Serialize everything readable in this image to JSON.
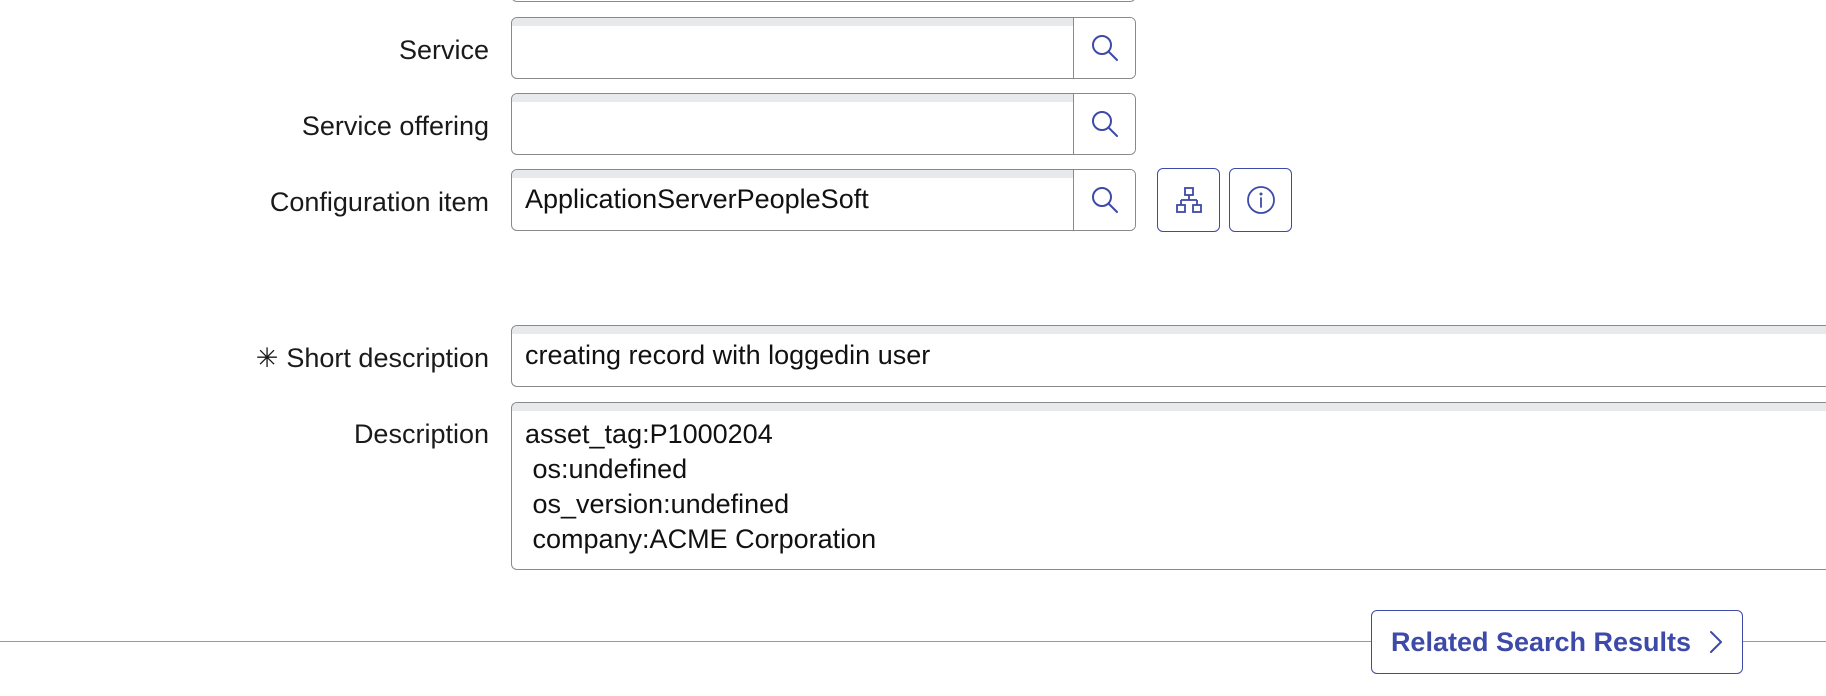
{
  "form": {
    "service": {
      "label": "Service",
      "value": "",
      "lookup_icon": "search-icon"
    },
    "service_offering": {
      "label": "Service offering",
      "value": "",
      "lookup_icon": "search-icon"
    },
    "configuration_item": {
      "label": "Configuration item",
      "value": "ApplicationServerPeopleSoft",
      "lookup_icon": "search-icon",
      "extra_icons": [
        "dependency-map-icon",
        "info-icon"
      ]
    },
    "short_description": {
      "required_marker": "✳",
      "label": "Short description",
      "value": "creating record with loggedin user"
    },
    "description": {
      "label": "Description",
      "lines": [
        "asset_tag:P1000204",
        " os:undefined",
        " os_version:undefined",
        " company:ACME Corporation"
      ]
    }
  },
  "related_search": {
    "label": "Related Search Results",
    "icon": "chevron-right-icon"
  },
  "colors": {
    "accent": "#3e4aa8",
    "field_border": "#8a8a8a",
    "field_top_band": "#e7e9ea"
  }
}
